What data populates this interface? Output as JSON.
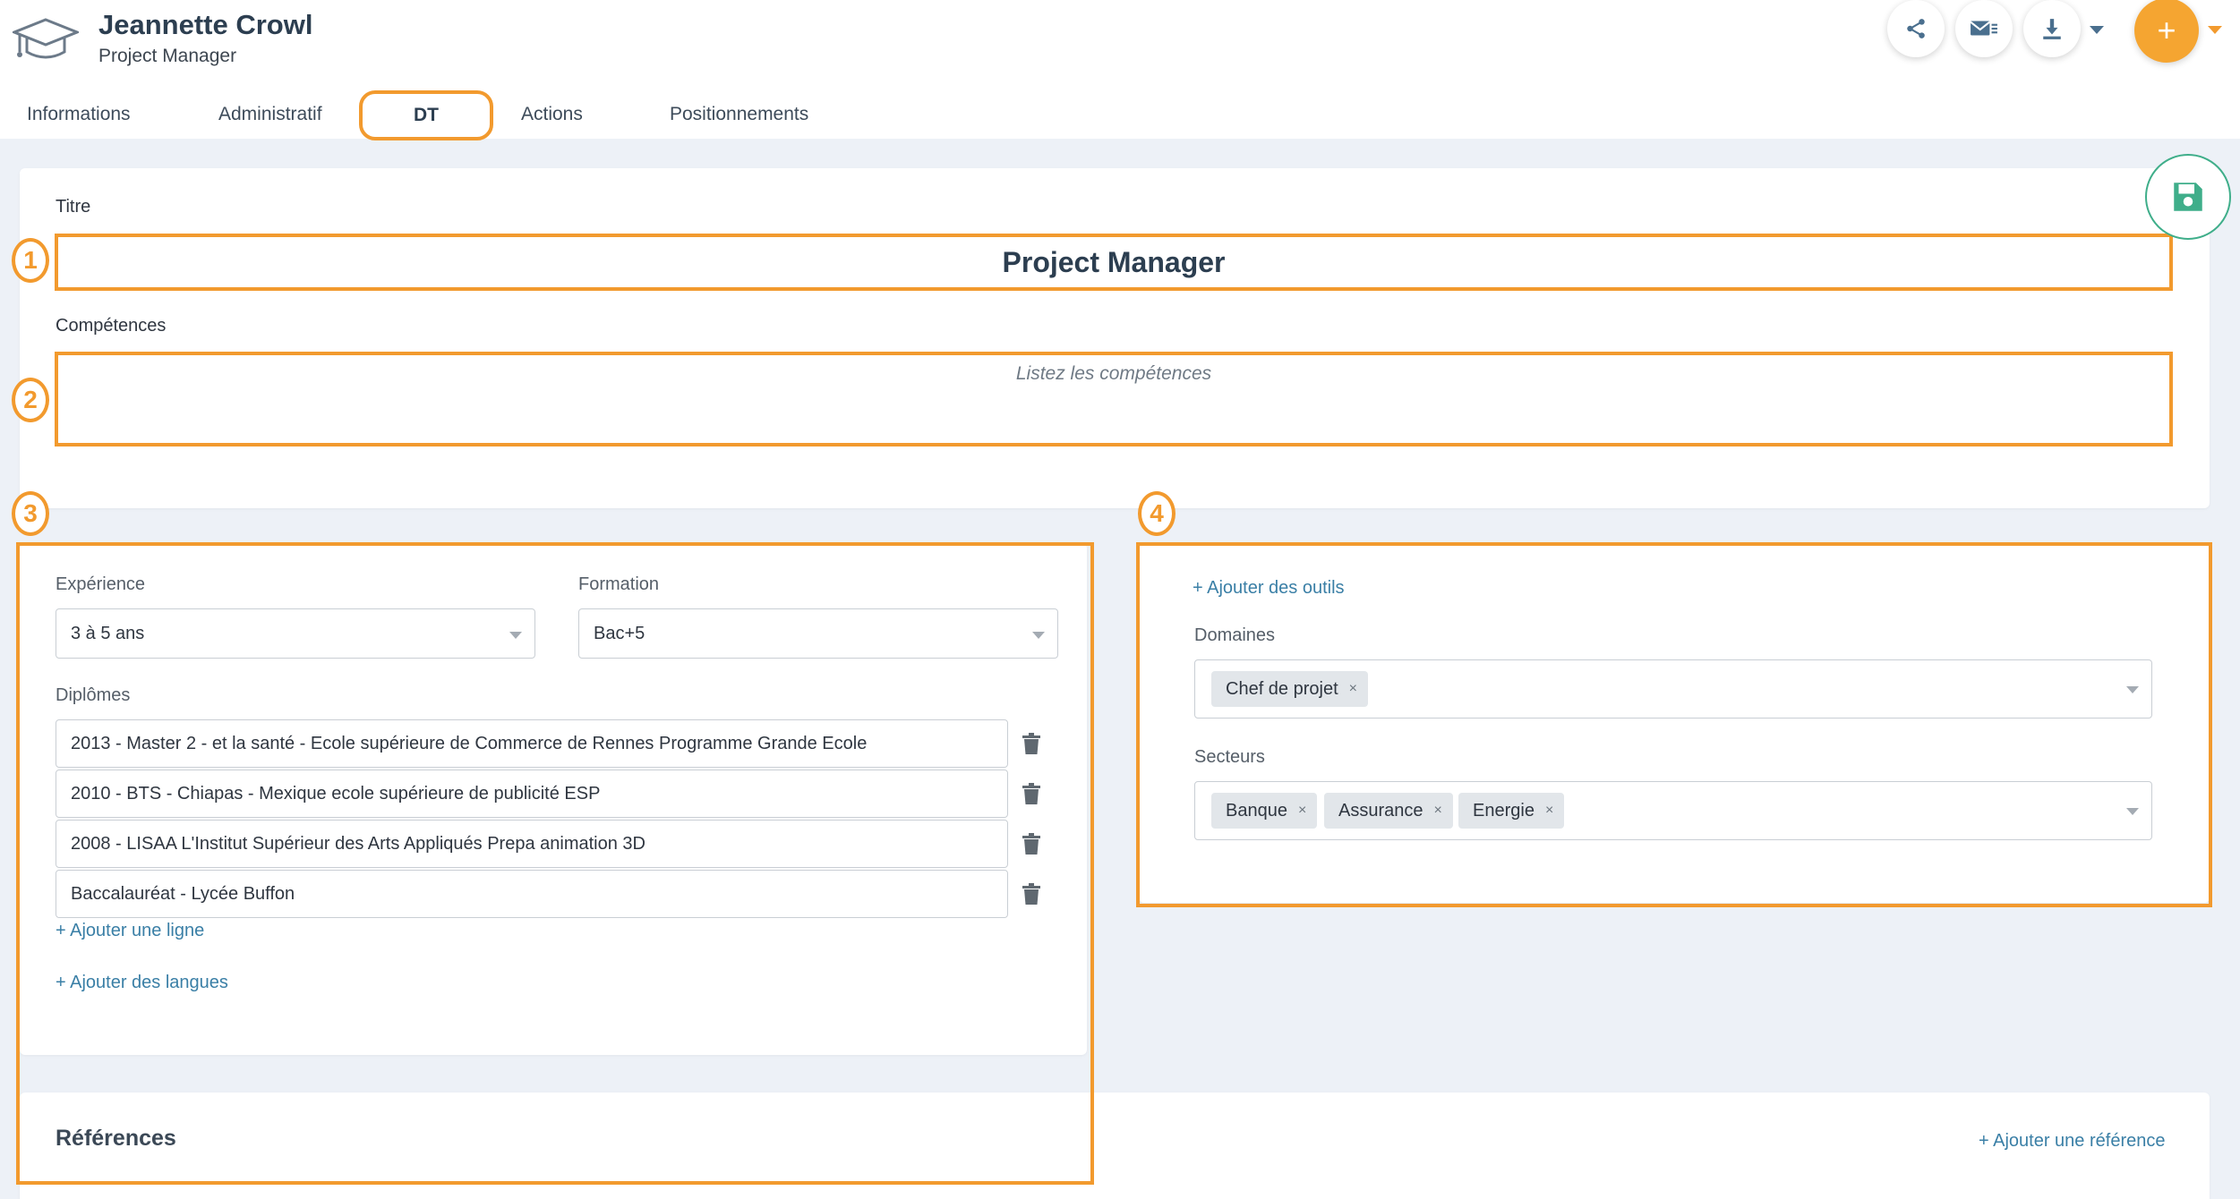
{
  "header": {
    "user_name": "Jeannette Crowl",
    "user_role": "Project Manager",
    "plus_label": "+"
  },
  "tabs": [
    {
      "label": "Informations"
    },
    {
      "label": "Administratif"
    },
    {
      "label": "DT",
      "active": true
    },
    {
      "label": "Actions"
    },
    {
      "label": "Positionnements"
    }
  ],
  "annotations": [
    "1",
    "2",
    "3",
    "4"
  ],
  "form": {
    "titre_label": "Titre",
    "titre_value": "Project Manager",
    "competences_label": "Compétences",
    "competences_placeholder": "Listez les compétences",
    "experience_label": "Expérience",
    "experience_value": "3 à 5 ans",
    "formation_label": "Formation",
    "formation_value": "Bac+5",
    "diplomes_label": "Diplômes",
    "diplomes": [
      "2013 - Master 2 - et la santé - Ecole supérieure de Commerce de Rennes Programme Grande Ecole",
      "2010 - BTS - Chiapas - Mexique ecole supérieure de publicité ESP",
      "2008 - LISAA L'Institut Supérieur des Arts Appliqués Prepa animation 3D",
      "Baccalauréat - Lycée Buffon"
    ],
    "add_line": "+ Ajouter une ligne",
    "add_languages": "+ Ajouter des langues",
    "add_tools": "+ Ajouter des outils",
    "domaines_label": "Domaines",
    "domaines": [
      "Chef de projet"
    ],
    "secteurs_label": "Secteurs",
    "secteurs": [
      "Banque",
      "Assurance",
      "Energie"
    ],
    "tag_remove": "×"
  },
  "references": {
    "title": "Références",
    "add_reference": "+ Ajouter une référence"
  },
  "colors": {
    "accent_orange": "#f29a2e",
    "fab_orange": "#f5a531",
    "save_green": "#3fae8a",
    "link_blue": "#3a7fa6"
  },
  "icons": [
    "graduation-cap-icon",
    "share-icon",
    "mail-list-icon",
    "download-icon",
    "chevron-down-icon",
    "plus-icon",
    "save-icon",
    "trash-icon",
    "remove-tag-icon"
  ]
}
